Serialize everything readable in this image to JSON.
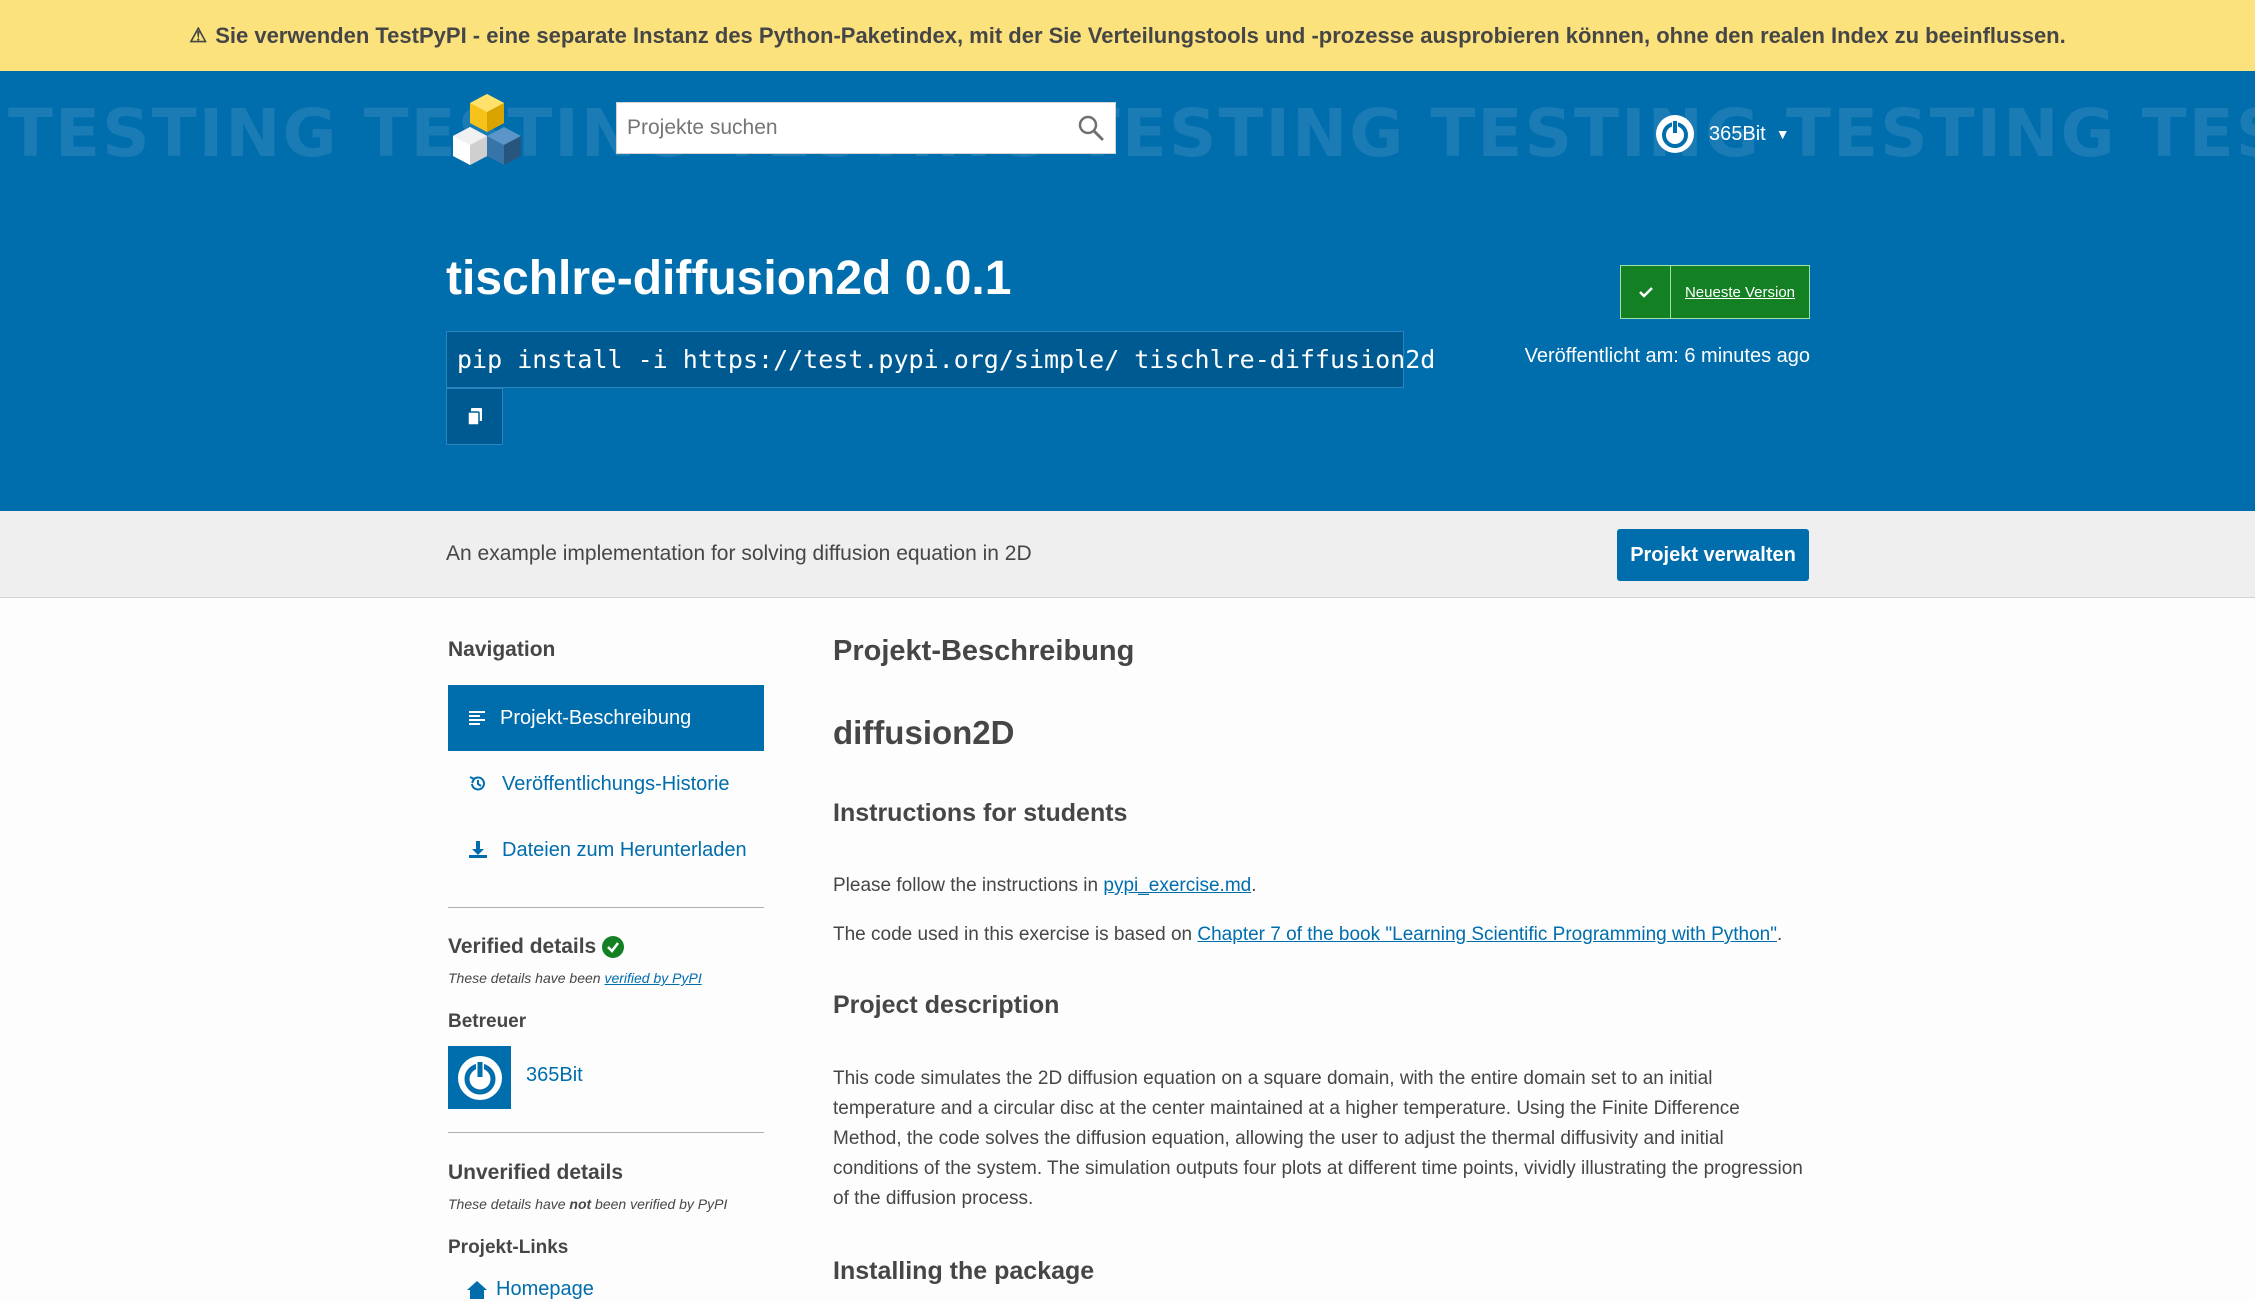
{
  "banner": {
    "text": "Sie verwenden TestPyPI - eine separate Instanz des Python-Paketindex, mit der Sie Verteilungstools und -prozesse ausprobieren können, ohne den realen Index zu beeinflussen."
  },
  "header": {
    "watermark": "TESTING TESTING TESTING TESTING TESTING TESTING TESTING TESTING",
    "search_placeholder": "Projekte suchen",
    "username": "365Bit"
  },
  "package": {
    "title": "tischlre-diffusion2d 0.0.1",
    "pip_command": "pip install -i https://test.pypi.org/simple/ tischlre-diffusion2d",
    "latest_label": "Neueste Version",
    "released": "Veröffentlicht am: 6 minutes ago"
  },
  "summary": {
    "text": "An example implementation for solving diffusion equation in 2D",
    "manage_button": "Projekt verwalten"
  },
  "sidebar": {
    "nav_title": "Navigation",
    "items": [
      {
        "label": "Projekt-Beschreibung"
      },
      {
        "label": "Veröffentlichungs-Historie"
      },
      {
        "label": "Dateien zum Herunterladen"
      }
    ],
    "verified_title": "Verified details",
    "verified_note_prefix": "These details have been ",
    "verified_note_link": "verified by PyPI",
    "maintainers_title": "Betreuer",
    "maintainer": "365Bit",
    "unverified_title": "Unverified details",
    "unverified_note_prefix": "These details have ",
    "unverified_note_bold": "not",
    "unverified_note_suffix": " been verified by PyPI",
    "project_links_title": "Projekt-Links",
    "homepage": "Homepage"
  },
  "main": {
    "section_title": "Projekt-Beschreibung",
    "readme_title": "diffusion2D",
    "instructions_heading": "Instructions for students",
    "instructions_prefix": "Please follow the instructions in ",
    "instructions_link": "pypi_exercise.md",
    "instructions_suffix": ".",
    "code_prefix": "The code used in this exercise is based on ",
    "code_link": "Chapter 7 of the book \"Learning Scientific Programming with Python\"",
    "code_suffix": ".",
    "project_desc_heading": "Project description",
    "project_desc": "This code simulates the 2D diffusion equation on a square domain, with the entire domain set to an initial temperature and a circular disc at the center maintained at a higher temperature. Using the Finite Difference Method, the code solves the diffusion equation, allowing the user to adjust the thermal diffusivity and initial conditions of the system. The simulation outputs four plots at different time points, vividly illustrating the progression of the diffusion process.",
    "installing_heading": "Installing the package"
  },
  "colors": {
    "brand_blue": "#006dad",
    "banner_yellow": "#fbe27d",
    "verified_green": "#148024"
  }
}
